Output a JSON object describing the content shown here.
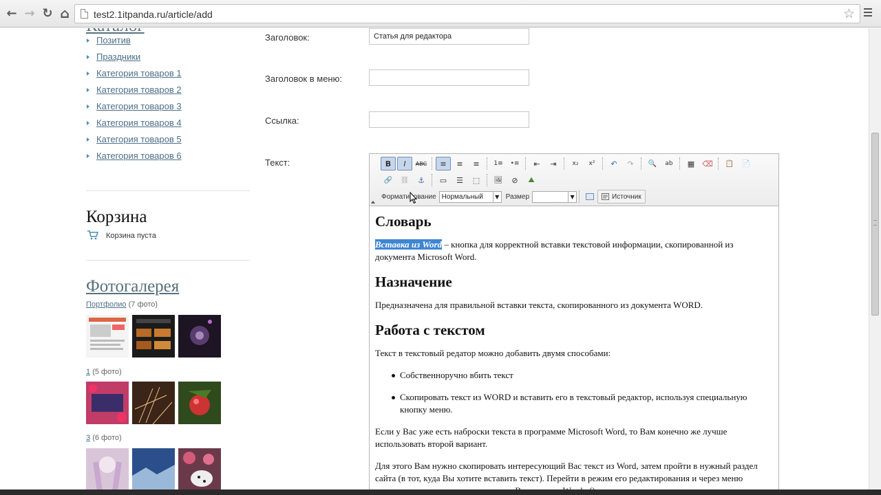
{
  "browser": {
    "url": "test2.1itpanda.ru/article/add",
    "back_icon": "←",
    "forward_icon": "→",
    "reload_icon": "↻",
    "home_icon": "⌂",
    "star_icon": "☆"
  },
  "sidebar": {
    "catalog_title": "Каталог",
    "categories": [
      "Позитив",
      "Праздники",
      "Категория товаров 1",
      "Категория товаров 2",
      "Категория товаров 3",
      "Категория товаров 4",
      "Категория товаров 5",
      "Категория товаров 6"
    ],
    "cart_title": "Корзина",
    "cart_status": "Корзина пуста",
    "gallery_title": "Фотогалерея",
    "albums": [
      {
        "name": "Портфолио",
        "count": "(7 фото)"
      },
      {
        "name": "1",
        "count": "(5 фото)"
      },
      {
        "name": "3",
        "count": "(6 фото)"
      }
    ]
  },
  "form": {
    "title_label": "Заголовок:",
    "title_value": "Статья для редактора",
    "menu_title_label": "Заголовок в меню:",
    "menu_title_value": "",
    "link_label": "Ссылка:",
    "link_value": "",
    "text_label": "Текст:"
  },
  "editor": {
    "toolbar": {
      "format_label": "Форматирование",
      "format_value": "Нормальный",
      "size_label": "Размер",
      "size_value": "",
      "source_label": "Источник",
      "row1": [
        "B",
        "I",
        "ABC",
        "≡",
        "≡",
        "≡",
        "1≡",
        "•≡",
        "⇤",
        "⇥",
        "x₂",
        "x²",
        "↶",
        "↷",
        "🔍",
        "ab",
        "▦",
        "⌫",
        "📋",
        "📄"
      ],
      "row2": [
        "🔗",
        "⛓",
        "⚓",
        "▭",
        "☰",
        "⬚",
        "🖼",
        "⊘",
        "⛰"
      ]
    },
    "content": {
      "h1": "Словарь",
      "p1_highlight": "Вставка из Word",
      "p1_rest": " – кнопка для корректной вставки текстовой информации, скопированной из документа Microsoft Word.",
      "h2": "Назначение",
      "p2": "Предназначена для правильной вставки текста, скопированного из документа WORD.",
      "h3": "Работа с текстом",
      "p3": "Текст в текстовый редатор можно добавить двумя способами:",
      "bullets": [
        "Собственноручно вбить текст",
        "Скопировать текст из WORD и вставить его в текстовый редактор, используя специальную кнопку меню."
      ],
      "p4": "Если у Вас уже есть наброски текста в программе Microsoft Word, то Вам конечно же лучше использовать второй вариант.",
      "p5": "Для этого Вам нужно скопировать интересующий Вас текст из Word, затем пройти в нужный раздел сайта (в тот, куда Вы хотите вставить текст). Перейти в режим его редактирования и через меню редактора текста нажать на кнопку «Вставить из Word» ()."
    }
  },
  "colors": {
    "link": "#4c6f88",
    "accent": "#3f86d2",
    "toolbar_active": "#c7d6ea"
  }
}
